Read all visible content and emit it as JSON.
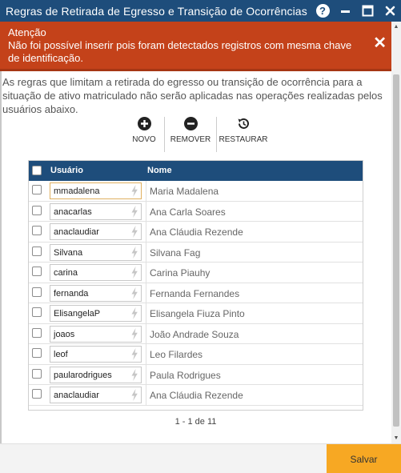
{
  "window": {
    "title": "Regras de Retirada de Egresso e Transição de Ocorrências",
    "help_icon": "?"
  },
  "alert": {
    "title": "Atenção",
    "message": "Não foi possível inserir pois foram detectados registros com mesma chave de identificação.",
    "color": "#c4421a"
  },
  "description": "As regras que limitam a retirada do egresso ou transição de ocorrência para a situação de ativo matriculado não serão aplicadas nas operações realizadas pelos usuários abaixo.",
  "toolbar": {
    "new_label": "NOVO",
    "remove_label": "REMOVER",
    "restore_label": "RESTAURAR"
  },
  "grid": {
    "col_user": "Usuário",
    "col_name": "Nome",
    "header_color": "#1e4d7b",
    "rows": [
      {
        "user": "mmadalena",
        "name": "Maria Madalena"
      },
      {
        "user": "anacarlas",
        "name": "Ana Carla Soares"
      },
      {
        "user": "anaclaudiar",
        "name": "Ana Cláudia Rezende"
      },
      {
        "user": "Silvana",
        "name": "Silvana Fag"
      },
      {
        "user": "carina",
        "name": "Carina Piauhy"
      },
      {
        "user": "fernanda",
        "name": "Fernanda Fernandes"
      },
      {
        "user": "ElisangelaP",
        "name": "Elisangela Fiuza Pinto"
      },
      {
        "user": "joaos",
        "name": "João Andrade Souza"
      },
      {
        "user": "leof",
        "name": "Leo Filardes"
      },
      {
        "user": "paularodrigues",
        "name": "Paula Rodrigues"
      },
      {
        "user": "anaclaudiar",
        "name": "Ana Cláudia Rezende"
      }
    ]
  },
  "pager": "1 - 1 de 11",
  "footer": {
    "save_label": "Salvar",
    "save_color": "#f7a823"
  }
}
